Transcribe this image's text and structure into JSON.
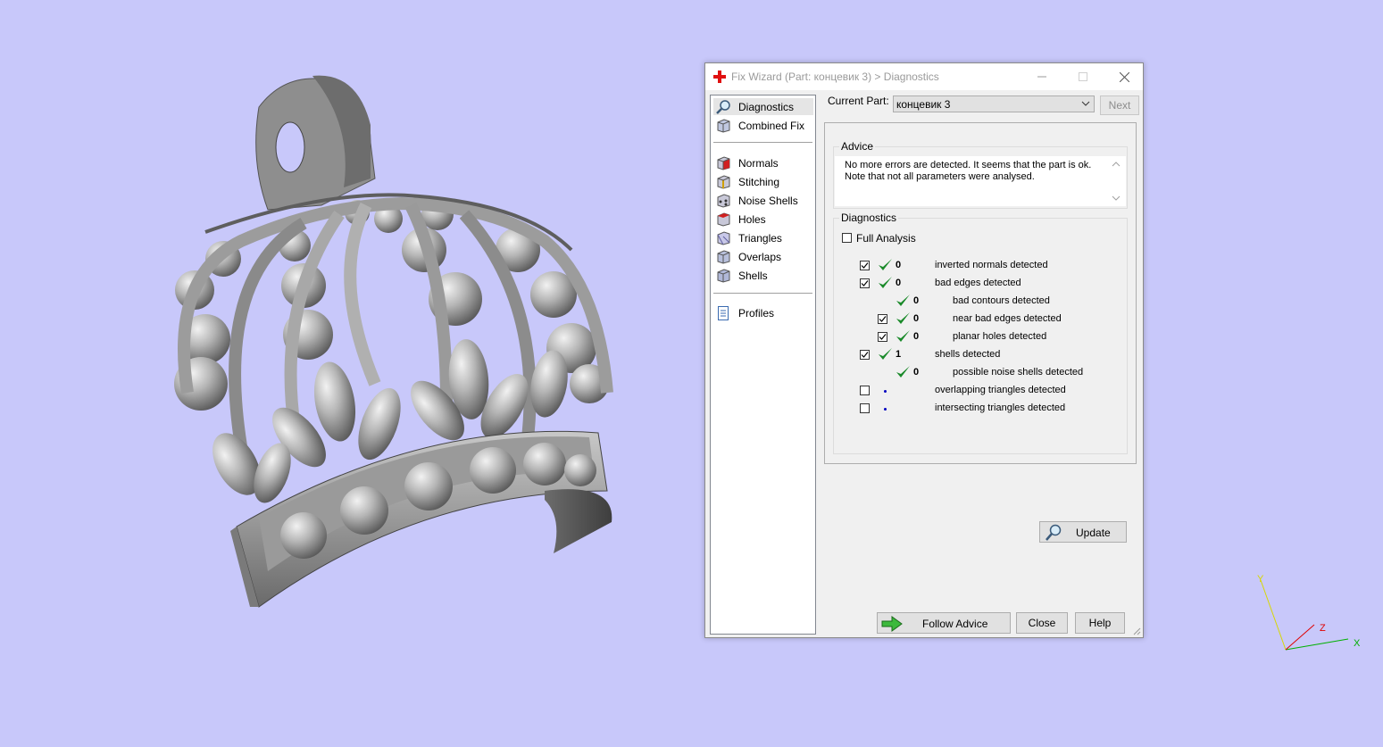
{
  "dialog": {
    "title": "Fix Wizard (Part: концевик 3) > Diagnostics",
    "icon": "red-cross-icon"
  },
  "nav": {
    "top_items": [
      {
        "label": "Diagnostics",
        "icon": "magnifier-icon",
        "selected": true
      },
      {
        "label": "Combined Fix",
        "icon": "cube-icon"
      }
    ],
    "fix_items": [
      {
        "label": "Normals",
        "icon": "normals-cube-icon"
      },
      {
        "label": "Stitching",
        "icon": "stitching-cube-icon"
      },
      {
        "label": "Noise Shells",
        "icon": "noise-shells-cube-icon"
      },
      {
        "label": "Holes",
        "icon": "holes-cube-icon"
      },
      {
        "label": "Triangles",
        "icon": "triangles-cube-icon"
      },
      {
        "label": "Overlaps",
        "icon": "overlaps-cube-icon"
      },
      {
        "label": "Shells",
        "icon": "shells-cube-icon"
      }
    ],
    "bottom_items": [
      {
        "label": "Profiles",
        "icon": "document-icon"
      }
    ]
  },
  "current_part": {
    "label": "Current Part:",
    "value": "концевик 3",
    "next_label": "Next"
  },
  "advice": {
    "title": "Advice",
    "text_line1": "No more errors are detected. It seems that the part is ok.",
    "text_line2": "Note that not all parameters were analysed."
  },
  "diagnostics": {
    "title": "Diagnostics",
    "full_analysis_label": "Full Analysis",
    "full_analysis_checked": false,
    "rows": [
      {
        "checkbox": true,
        "checked": true,
        "status": "ok",
        "count": "0",
        "label": "inverted normals detected",
        "indent": 0
      },
      {
        "checkbox": true,
        "checked": true,
        "status": "ok",
        "count": "0",
        "label": "bad edges detected",
        "indent": 0
      },
      {
        "checkbox": false,
        "checked": false,
        "status": "ok",
        "count": "0",
        "label": "bad contours detected",
        "indent": 1
      },
      {
        "checkbox": true,
        "checked": true,
        "status": "ok",
        "count": "0",
        "label": "near bad edges detected",
        "indent": 1
      },
      {
        "checkbox": true,
        "checked": true,
        "status": "ok",
        "count": "0",
        "label": "planar holes detected",
        "indent": 1
      },
      {
        "checkbox": true,
        "checked": true,
        "status": "ok",
        "count": "1",
        "label": "shells detected",
        "indent": 0
      },
      {
        "checkbox": false,
        "checked": false,
        "status": "ok",
        "count": "0",
        "label": "possible noise shells detected",
        "indent": 1
      },
      {
        "checkbox": true,
        "checked": false,
        "status": "none",
        "count": "",
        "label": "overlapping triangles detected",
        "indent": 0
      },
      {
        "checkbox": true,
        "checked": false,
        "status": "none",
        "count": "",
        "label": "intersecting triangles detected",
        "indent": 0
      }
    ],
    "update_label": "Update"
  },
  "buttons": {
    "follow_advice": "Follow Advice",
    "close": "Close",
    "help": "Help"
  },
  "axes": {
    "x": "X",
    "y": "Y",
    "z": "Z"
  },
  "colors": {
    "background": "#c8c8fa",
    "ok_check": "#1a8a2a",
    "follow_arrow": "#3cb93c"
  }
}
